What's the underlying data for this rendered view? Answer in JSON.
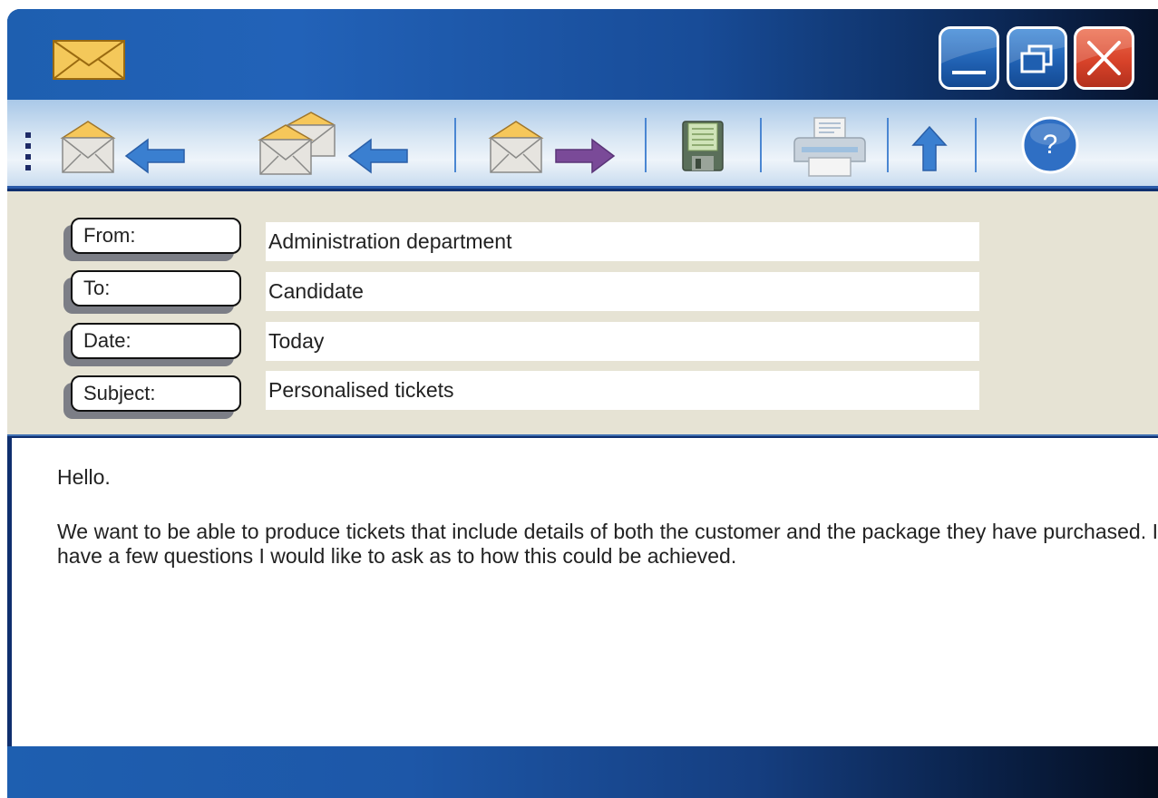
{
  "titlebar": {
    "app_icon": "envelope-icon",
    "buttons": [
      {
        "icon": "minimize-icon"
      },
      {
        "icon": "restore-icon"
      },
      {
        "icon": "close-icon"
      }
    ]
  },
  "toolbar": {
    "items": [
      {
        "icon": "reply-icon"
      },
      {
        "icon": "reply-all-icon"
      },
      {
        "icon": "forward-icon"
      },
      {
        "icon": "save-icon"
      },
      {
        "icon": "print-icon"
      },
      {
        "icon": "up-arrow-icon"
      },
      {
        "icon": "help-icon",
        "label": "?"
      }
    ]
  },
  "header": {
    "fields": [
      {
        "label": "From:",
        "value": "Administration department"
      },
      {
        "label": "To:",
        "value": "Candidate"
      },
      {
        "label": "Date:",
        "value": "Today"
      },
      {
        "label": "Subject:",
        "value": "Personalised tickets"
      }
    ]
  },
  "body": {
    "greeting": "Hello.",
    "paragraph": "We want to be able to produce tickets that include details of both the customer and the package they have purchased. I have a few questions I would like to ask as to how this could be achieved."
  },
  "colors": {
    "titlebar": "#1e5fb0",
    "header_bg": "#e6e3d4",
    "close_button": "#d8432a",
    "forward_arrow": "#7a4a98",
    "back_arrow": "#3a7fd0"
  }
}
